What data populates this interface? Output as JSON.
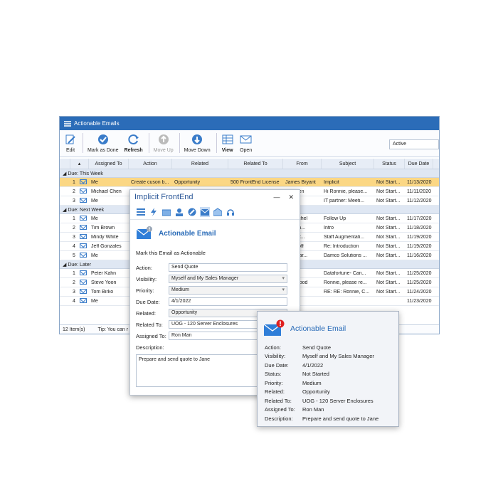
{
  "window": {
    "title": "Actionable Emails"
  },
  "toolbar": {
    "edit": "Edit",
    "mark_done": "Mark as Done",
    "refresh": "Refresh",
    "move_up": "Move Up",
    "move_down": "Move Down",
    "view": "View",
    "open": "Open",
    "filter_value": "Active"
  },
  "grid": {
    "columns": [
      "Assigned To",
      "Action",
      "Related",
      "Related To",
      "From",
      "Subject",
      "Status",
      "Due Date"
    ],
    "groups": [
      {
        "label": "Due: This Week",
        "rows": [
          {
            "n": "1",
            "assigned": "Me",
            "action": "Create cuson b...",
            "related": "Opportunity",
            "related_to": "500 FrontEnd License",
            "from": "James Bryant",
            "subject": "Implicit",
            "status": "Not Start...",
            "due": "11/13/2020"
          },
          {
            "n": "2",
            "assigned": "Michael Chen",
            "action": "",
            "related": "",
            "related_to": "",
            "from": "n Cohen",
            "subject": "Hi Ronnie, please...",
            "status": "Not Start...",
            "due": "11/11/2020"
          },
          {
            "n": "3",
            "assigned": "Me",
            "action": "",
            "related": "",
            "related_to": "",
            "from": "bin",
            "subject": "IT partner: Meeti...",
            "status": "Not Start...",
            "due": "11/12/2020"
          }
        ]
      },
      {
        "label": "Due: Next Week",
        "rows": [
          {
            "n": "1",
            "assigned": "Me",
            "action": "",
            "related": "",
            "related_to": "",
            "from": "sa Rachel",
            "subject": "Follow Up",
            "status": "Not Start...",
            "due": "11/17/2020"
          },
          {
            "n": "2",
            "assigned": "Tim Brown",
            "action": "",
            "related": "",
            "related_to": "",
            "from": "rshi Ch...",
            "subject": "Intro",
            "status": "Not Start...",
            "due": "11/18/2020"
          },
          {
            "n": "3",
            "assigned": "Mindy White",
            "action": "",
            "related": "",
            "related_to": "",
            "from": "ia Rust...",
            "subject": "Staff Augmentati...",
            "status": "Not Start...",
            "due": "11/19/2020"
          },
          {
            "n": "4",
            "assigned": "Jeff Gonzales",
            "action": "",
            "related": "",
            "related_to": "",
            "from": "n T. Roff",
            "subject": "Re: Introduction",
            "status": "Not Start...",
            "due": "11/19/2020"
          },
          {
            "n": "5",
            "assigned": "Me",
            "action": "",
            "related": "",
            "related_to": "",
            "from": "ish Shar...",
            "subject": "Damco Solutions ...",
            "status": "Not Start...",
            "due": "11/16/2020"
          }
        ]
      },
      {
        "label": "Due: Later",
        "rows": [
          {
            "n": "1",
            "assigned": "Peter Kahn",
            "action": "",
            "related": "",
            "related_to": "",
            "from": "t Bhati",
            "subject": "Datafortune- Can...",
            "status": "Not Start...",
            "due": "11/25/2020"
          },
          {
            "n": "2",
            "assigned": "Steve Yoon",
            "action": "",
            "related": "",
            "related_to": "",
            "from": "rew Wood",
            "subject": "Ronnie, please re...",
            "status": "Not Start...",
            "due": "11/25/2020"
          },
          {
            "n": "3",
            "assigned": "Tom Birko",
            "action": "",
            "related": "",
            "related_to": "",
            "from": "T",
            "subject": "RE: RE: Ronnie, C...",
            "status": "Not Start...",
            "due": "11/24/2020"
          },
          {
            "n": "4",
            "assigned": "Me",
            "action": "",
            "related": "",
            "related_to": "",
            "from": "",
            "subject": "",
            "status": "",
            "due": "11/23/2020"
          }
        ]
      }
    ],
    "footer_count": "12 Item(s)",
    "footer_tip": "Tip: You can r"
  },
  "dialog": {
    "title": "Implicit FrontEnd",
    "heading": "Actionable Email",
    "subtitle": "Mark this Email as Actionable",
    "fields": {
      "action_label": "Action:",
      "action_value": "Send Quote",
      "visibility_label": "Visibility:",
      "visibility_value": "Myself and My Sales Manager",
      "priority_label": "Priority:",
      "priority_value": "Medium",
      "due_label": "Due Date:",
      "due_value": "4/1/2022",
      "related_label": "Related:",
      "related_value": "Opportunity",
      "related_to_label": "Related To:",
      "related_to_value": "UOG - 120 Server Enclosures",
      "assigned_label": "Assigned To:",
      "assigned_value": "Ron Man",
      "description_label": "Description:",
      "description_value": "Prepare and send quote to Jane"
    }
  },
  "card": {
    "heading": "Actionable Email",
    "rows": [
      {
        "k": "Action:",
        "v": "Send Quote"
      },
      {
        "k": "Visibility:",
        "v": "Myself and My Sales Manager"
      },
      {
        "k": "Due Date:",
        "v": "4/1/2022"
      },
      {
        "k": "Status:",
        "v": "Not Started"
      },
      {
        "k": "Priority:",
        "v": "Medium"
      },
      {
        "k": "Related:",
        "v": "Opportunity"
      },
      {
        "k": "Related To:",
        "v": "UOG - 120 Server Enclosures"
      },
      {
        "k": "Assigned To:",
        "v": "Ron Man"
      },
      {
        "k": "Description:",
        "v": "Prepare and send quote to Jane"
      }
    ]
  },
  "colors": {
    "accent": "#2b6cb8",
    "selected_row": "#fbd784",
    "alert": "#e02020"
  }
}
